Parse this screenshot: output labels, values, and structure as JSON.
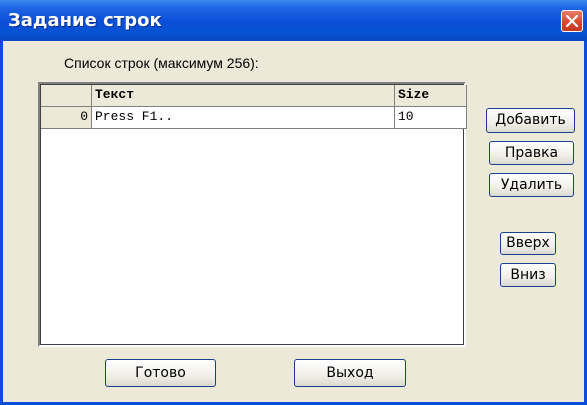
{
  "window": {
    "title": "Задание строк"
  },
  "list": {
    "label": "Список строк (максимум 256):",
    "columns": [
      "",
      "Текст",
      "Size"
    ],
    "rows": [
      {
        "index": "0",
        "text": "Press F1..",
        "size": "10"
      }
    ]
  },
  "buttons": {
    "add": "Добавить",
    "edit": "Правка",
    "delete": "Удалить",
    "up": "Вверх",
    "down": "Вниз",
    "done": "Готово",
    "exit": "Выход"
  },
  "colors": {
    "titlebar": "#0a4ed8",
    "dialog_bg": "#ece9d8",
    "close_button": "#d7482f"
  },
  "icons": {
    "close": "close-icon"
  }
}
